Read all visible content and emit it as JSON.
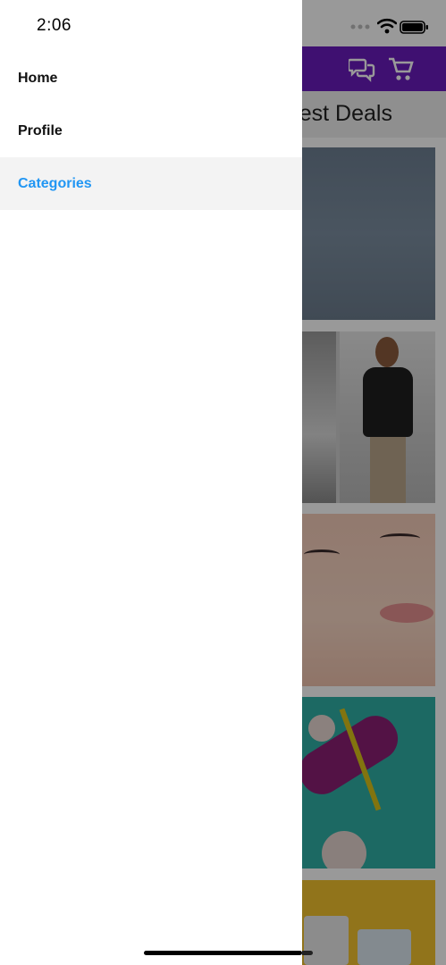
{
  "status_bar": {
    "time": "2:06"
  },
  "background_app": {
    "section_title": "Latest Deals",
    "header_icons": [
      "chat-bubbles-icon",
      "cart-icon"
    ],
    "header_color": "#6a1bbd"
  },
  "drawer": {
    "items": [
      {
        "label": "Home",
        "active": false
      },
      {
        "label": "Profile",
        "active": false
      },
      {
        "label": "Categories",
        "active": true
      }
    ],
    "active_color": "#2196f3"
  }
}
